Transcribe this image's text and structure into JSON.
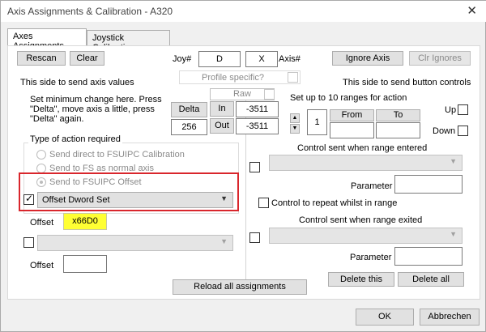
{
  "window": {
    "title": "Axis Assignments & Calibration - A320",
    "close_glyph": "✕"
  },
  "tabs": [
    {
      "label": "Axes Assignments"
    },
    {
      "label": "Joystick Calibration"
    }
  ],
  "toolbar": {
    "rescan_label": "Rescan",
    "clear_label": "Clear",
    "joy_label": "Joy#",
    "joy_value": "D",
    "axis_value": "X",
    "axis_label": "Axis#",
    "ignore_axis_label": "Ignore Axis",
    "clr_ignores_label": "Clr Ignores",
    "profile_specific_label": "Profile specific?"
  },
  "left": {
    "heading": "This side to send axis values",
    "instructions": [
      "Set minimum change here. Press",
      "\"Delta\", move axis a little, press",
      "\"Delta\" again."
    ],
    "delta_label": "Delta",
    "delta_value": "256",
    "raw_label": "Raw",
    "in_label": "In",
    "in_value": "-3511",
    "out_label": "Out",
    "out_value": "-3511",
    "type_heading": "Type of action required",
    "options": [
      {
        "label": "Send direct to FSUIPC Calibration"
      },
      {
        "label": "Send to FS as normal axis"
      },
      {
        "label": "Send to FSUIPC Offset"
      }
    ],
    "selected_action": "Offset Dword Set",
    "offset_label": "Offset",
    "offset_value": "x66D0",
    "offset2_label": "Offset",
    "offset2_value": ""
  },
  "right": {
    "heading": "This side to send button controls",
    "ranges_label": "Set up to 10 ranges for action",
    "range_index": "1",
    "from_label": "From",
    "to_label": "To",
    "up_label": "Up",
    "down_label": "Down",
    "control_entered_label": "Control sent when range entered",
    "parameter_label": "Parameter",
    "repeat_label": "Control to repeat whilst in range",
    "control_exited_label": "Control sent when range exited",
    "parameter2_label": "Parameter",
    "delete_this_label": "Delete this",
    "delete_all_label": "Delete all"
  },
  "reload_label": "Reload all assignments",
  "footer": {
    "ok_label": "OK",
    "cancel_label": "Abbrechen"
  },
  "colors": {
    "highlight_border": "#d9262c",
    "offset_fill": "#ffff33"
  }
}
